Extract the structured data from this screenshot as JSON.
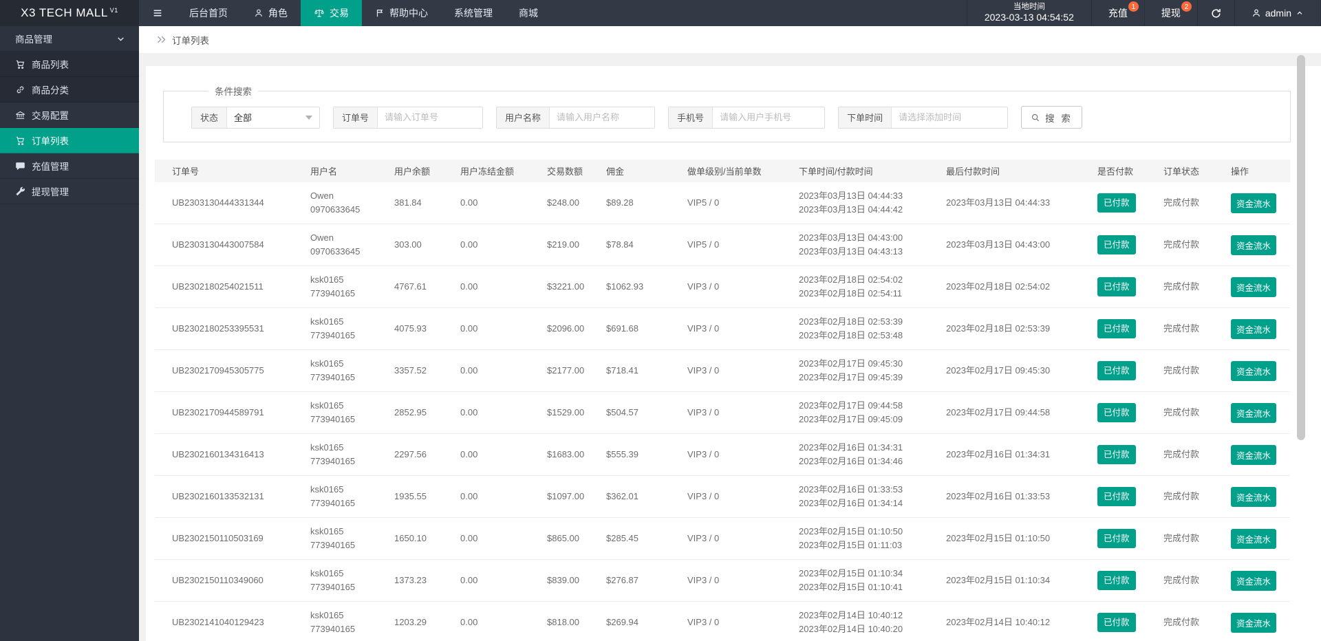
{
  "colors": {
    "accent": "#00a08b",
    "badge": "#f96a3d",
    "topbar_bg": "#343a45",
    "sidebar_bg": "#2e3340"
  },
  "topbar": {
    "logo": "X3 TECH MALL",
    "logo_sup": "V1",
    "nav": [
      {
        "label": "后台首页"
      },
      {
        "label": "角色"
      },
      {
        "label": "交易",
        "active": true
      },
      {
        "label": "帮助中心"
      },
      {
        "label": "系统管理"
      },
      {
        "label": "商城"
      }
    ],
    "local_time_label": "当地时间",
    "local_time_value": "2023-03-13 04:54:52",
    "recharge": {
      "label": "充值",
      "badge": "1"
    },
    "withdraw": {
      "label": "提现",
      "badge": "2"
    },
    "user": "admin"
  },
  "sidebar": {
    "items": [
      {
        "label": "商品管理"
      },
      {
        "label": "商品列表"
      },
      {
        "label": "商品分类"
      },
      {
        "label": "交易配置"
      },
      {
        "label": "订单列表",
        "active": true
      },
      {
        "label": "充值管理"
      },
      {
        "label": "提现管理"
      }
    ]
  },
  "breadcrumb": "订单列表",
  "filter": {
    "legend": "条件搜索",
    "status_label": "状态",
    "status_value": "全部",
    "order_no_label": "订单号",
    "order_no_placeholder": "请输入订单号",
    "username_label": "用户名称",
    "username_placeholder": "请输入用户名称",
    "phone_label": "手机号",
    "phone_placeholder": "请输入用户手机号",
    "time_label": "下单时间",
    "time_placeholder": "请选择添加时间",
    "search_label": "搜 索"
  },
  "table": {
    "headers": [
      "订单号",
      "用户名",
      "用户余额",
      "用户冻结金额",
      "交易数额",
      "佣金",
      "做单级别/当前单数",
      "下单时间/付款时间",
      "最后付款时间",
      "是否付款",
      "订单状态",
      "操作"
    ],
    "rows": [
      {
        "order_no": "UB2303130444331344",
        "user_name": "Owen",
        "user_account": "0970633645",
        "balance": "381.84",
        "frozen": "0.00",
        "amount": "$248.00",
        "commission": "$89.28",
        "level": "VIP5 / 0",
        "order_time": "2023年03月13日 04:44:33",
        "pay_time": "2023年03月13日 04:44:42",
        "last_pay_time": "2023年03月13日 04:44:33",
        "paid_label": "已付款",
        "status": "完成付款",
        "action_label": "资金流水"
      },
      {
        "order_no": "UB2303130443007584",
        "user_name": "Owen",
        "user_account": "0970633645",
        "balance": "303.00",
        "frozen": "0.00",
        "amount": "$219.00",
        "commission": "$78.84",
        "level": "VIP5 / 0",
        "order_time": "2023年03月13日 04:43:00",
        "pay_time": "2023年03月13日 04:43:13",
        "last_pay_time": "2023年03月13日 04:43:00",
        "paid_label": "已付款",
        "status": "完成付款",
        "action_label": "资金流水"
      },
      {
        "order_no": "UB2302180254021511",
        "user_name": "ksk0165",
        "user_account": "773940165",
        "balance": "4767.61",
        "frozen": "0.00",
        "amount": "$3221.00",
        "commission": "$1062.93",
        "level": "VIP3 / 0",
        "order_time": "2023年02月18日 02:54:02",
        "pay_time": "2023年02月18日 02:54:11",
        "last_pay_time": "2023年02月18日 02:54:02",
        "paid_label": "已付款",
        "status": "完成付款",
        "action_label": "资金流水"
      },
      {
        "order_no": "UB2302180253395531",
        "user_name": "ksk0165",
        "user_account": "773940165",
        "balance": "4075.93",
        "frozen": "0.00",
        "amount": "$2096.00",
        "commission": "$691.68",
        "level": "VIP3 / 0",
        "order_time": "2023年02月18日 02:53:39",
        "pay_time": "2023年02月18日 02:53:48",
        "last_pay_time": "2023年02月18日 02:53:39",
        "paid_label": "已付款",
        "status": "完成付款",
        "action_label": "资金流水"
      },
      {
        "order_no": "UB2302170945305775",
        "user_name": "ksk0165",
        "user_account": "773940165",
        "balance": "3357.52",
        "frozen": "0.00",
        "amount": "$2177.00",
        "commission": "$718.41",
        "level": "VIP3 / 0",
        "order_time": "2023年02月17日 09:45:30",
        "pay_time": "2023年02月17日 09:45:39",
        "last_pay_time": "2023年02月17日 09:45:30",
        "paid_label": "已付款",
        "status": "完成付款",
        "action_label": "资金流水"
      },
      {
        "order_no": "UB2302170944589791",
        "user_name": "ksk0165",
        "user_account": "773940165",
        "balance": "2852.95",
        "frozen": "0.00",
        "amount": "$1529.00",
        "commission": "$504.57",
        "level": "VIP3 / 0",
        "order_time": "2023年02月17日 09:44:58",
        "pay_time": "2023年02月17日 09:45:09",
        "last_pay_time": "2023年02月17日 09:44:58",
        "paid_label": "已付款",
        "status": "完成付款",
        "action_label": "资金流水"
      },
      {
        "order_no": "UB2302160134316413",
        "user_name": "ksk0165",
        "user_account": "773940165",
        "balance": "2297.56",
        "frozen": "0.00",
        "amount": "$1683.00",
        "commission": "$555.39",
        "level": "VIP3 / 0",
        "order_time": "2023年02月16日 01:34:31",
        "pay_time": "2023年02月16日 01:34:46",
        "last_pay_time": "2023年02月16日 01:34:31",
        "paid_label": "已付款",
        "status": "完成付款",
        "action_label": "资金流水"
      },
      {
        "order_no": "UB2302160133532131",
        "user_name": "ksk0165",
        "user_account": "773940165",
        "balance": "1935.55",
        "frozen": "0.00",
        "amount": "$1097.00",
        "commission": "$362.01",
        "level": "VIP3 / 0",
        "order_time": "2023年02月16日 01:33:53",
        "pay_time": "2023年02月16日 01:34:14",
        "last_pay_time": "2023年02月16日 01:33:53",
        "paid_label": "已付款",
        "status": "完成付款",
        "action_label": "资金流水"
      },
      {
        "order_no": "UB2302150110503169",
        "user_name": "ksk0165",
        "user_account": "773940165",
        "balance": "1650.10",
        "frozen": "0.00",
        "amount": "$865.00",
        "commission": "$285.45",
        "level": "VIP3 / 0",
        "order_time": "2023年02月15日 01:10:50",
        "pay_time": "2023年02月15日 01:11:03",
        "last_pay_time": "2023年02月15日 01:10:50",
        "paid_label": "已付款",
        "status": "完成付款",
        "action_label": "资金流水"
      },
      {
        "order_no": "UB2302150110349060",
        "user_name": "ksk0165",
        "user_account": "773940165",
        "balance": "1373.23",
        "frozen": "0.00",
        "amount": "$839.00",
        "commission": "$276.87",
        "level": "VIP3 / 0",
        "order_time": "2023年02月15日 01:10:34",
        "pay_time": "2023年02月15日 01:10:41",
        "last_pay_time": "2023年02月15日 01:10:34",
        "paid_label": "已付款",
        "status": "完成付款",
        "action_label": "资金流水"
      },
      {
        "order_no": "UB2302141040129423",
        "user_name": "ksk0165",
        "user_account": "773940165",
        "balance": "1203.29",
        "frozen": "0.00",
        "amount": "$818.00",
        "commission": "$269.94",
        "level": "VIP3 / 0",
        "order_time": "2023年02月14日 10:40:12",
        "pay_time": "2023年02月14日 10:40:20",
        "last_pay_time": "2023年02月14日 10:40:12",
        "paid_label": "已付款",
        "status": "完成付款",
        "action_label": "资金流水"
      }
    ]
  }
}
